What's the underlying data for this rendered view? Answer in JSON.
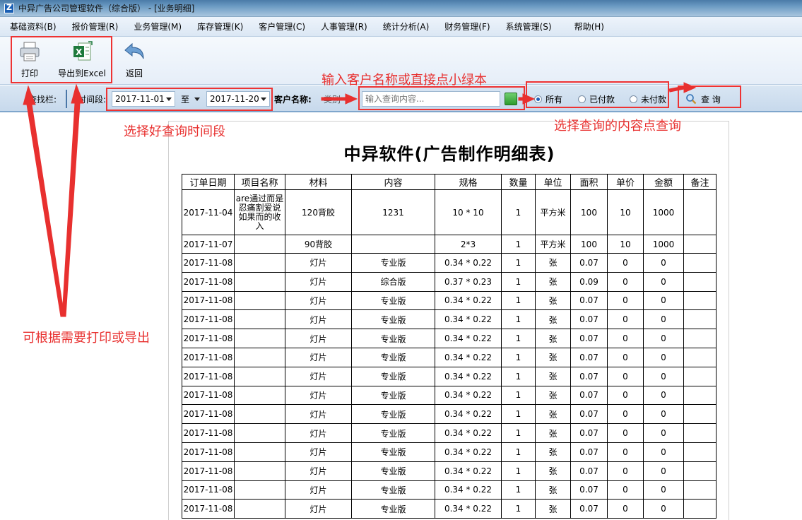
{
  "window": {
    "title": "中异广告公司管理软件（综合版） - [业务明细]"
  },
  "menu": [
    {
      "label": "基础资料(B)"
    },
    {
      "label": "报价管理(R)"
    },
    {
      "label": "业务管理(M)"
    },
    {
      "label": "库存管理(K)"
    },
    {
      "label": "客户管理(C)"
    },
    {
      "label": "人事管理(R)"
    },
    {
      "label": "统计分析(A)"
    },
    {
      "label": "财务管理(F)"
    },
    {
      "label": "系统管理(S)"
    },
    {
      "label": "帮助(H)"
    }
  ],
  "toolbar": {
    "print_label": "打印",
    "export_label": "导出到Excel",
    "back_label": "返回"
  },
  "searchbar": {
    "label": "查找栏:",
    "period_label": "时间段:",
    "start_date": "2017-11-01",
    "to_label": "至",
    "end_date": "2017-11-20",
    "customer_label": "客户名称:",
    "customer_type": "类别",
    "input_placeholder": "输入查询内容...",
    "radio_all": "所有",
    "radio_paid": "已付款",
    "radio_unpaid": "未付款",
    "query_label": "查 询"
  },
  "annotations": {
    "print_export": "可根据需要打印或导出",
    "time_period": "选择好查询时间段",
    "customer_hint": "输入客户名称或直接点小绿本",
    "query_hint": "选择查询的内容点查询",
    "color": "#e8302f"
  },
  "report": {
    "title": "中异软件(广告制作明细表)",
    "columns": [
      "订单日期",
      "项目名称",
      "材料",
      "内容",
      "规格",
      "数量",
      "单位",
      "面积",
      "单价",
      "金额",
      "备注"
    ],
    "rows": [
      [
        "2017-11-04",
        "are通过而是忍痛割爱说如果而的收入",
        "120背胶",
        "1231",
        "10 * 10",
        "1",
        "平方米",
        "100",
        "10",
        "1000",
        ""
      ],
      [
        "2017-11-07",
        "",
        "90背胶",
        "",
        "2*3",
        "1",
        "平方米",
        "100",
        "10",
        "1000",
        ""
      ],
      [
        "2017-11-08",
        "",
        "灯片",
        "专业版",
        "0.34 * 0.22",
        "1",
        "张",
        "0.07",
        "0",
        "0",
        ""
      ],
      [
        "2017-11-08",
        "",
        "灯片",
        "综合版",
        "0.37 * 0.23",
        "1",
        "张",
        "0.09",
        "0",
        "0",
        ""
      ],
      [
        "2017-11-08",
        "",
        "灯片",
        "专业版",
        "0.34 * 0.22",
        "1",
        "张",
        "0.07",
        "0",
        "0",
        ""
      ],
      [
        "2017-11-08",
        "",
        "灯片",
        "专业版",
        "0.34 * 0.22",
        "1",
        "张",
        "0.07",
        "0",
        "0",
        ""
      ],
      [
        "2017-11-08",
        "",
        "灯片",
        "专业版",
        "0.34 * 0.22",
        "1",
        "张",
        "0.07",
        "0",
        "0",
        ""
      ],
      [
        "2017-11-08",
        "",
        "灯片",
        "专业版",
        "0.34 * 0.22",
        "1",
        "张",
        "0.07",
        "0",
        "0",
        ""
      ],
      [
        "2017-11-08",
        "",
        "灯片",
        "专业版",
        "0.34 * 0.22",
        "1",
        "张",
        "0.07",
        "0",
        "0",
        ""
      ],
      [
        "2017-11-08",
        "",
        "灯片",
        "专业版",
        "0.34 * 0.22",
        "1",
        "张",
        "0.07",
        "0",
        "0",
        ""
      ],
      [
        "2017-11-08",
        "",
        "灯片",
        "专业版",
        "0.34 * 0.22",
        "1",
        "张",
        "0.07",
        "0",
        "0",
        ""
      ],
      [
        "2017-11-08",
        "",
        "灯片",
        "专业版",
        "0.34 * 0.22",
        "1",
        "张",
        "0.07",
        "0",
        "0",
        ""
      ],
      [
        "2017-11-08",
        "",
        "灯片",
        "专业版",
        "0.34 * 0.22",
        "1",
        "张",
        "0.07",
        "0",
        "0",
        ""
      ],
      [
        "2017-11-08",
        "",
        "灯片",
        "专业版",
        "0.34 * 0.22",
        "1",
        "张",
        "0.07",
        "0",
        "0",
        ""
      ],
      [
        "2017-11-08",
        "",
        "灯片",
        "专业版",
        "0.34 * 0.22",
        "1",
        "张",
        "0.07",
        "0",
        "0",
        ""
      ],
      [
        "2017-11-08",
        "",
        "灯片",
        "专业版",
        "0.34 * 0.22",
        "1",
        "张",
        "0.07",
        "0",
        "0",
        ""
      ]
    ]
  }
}
